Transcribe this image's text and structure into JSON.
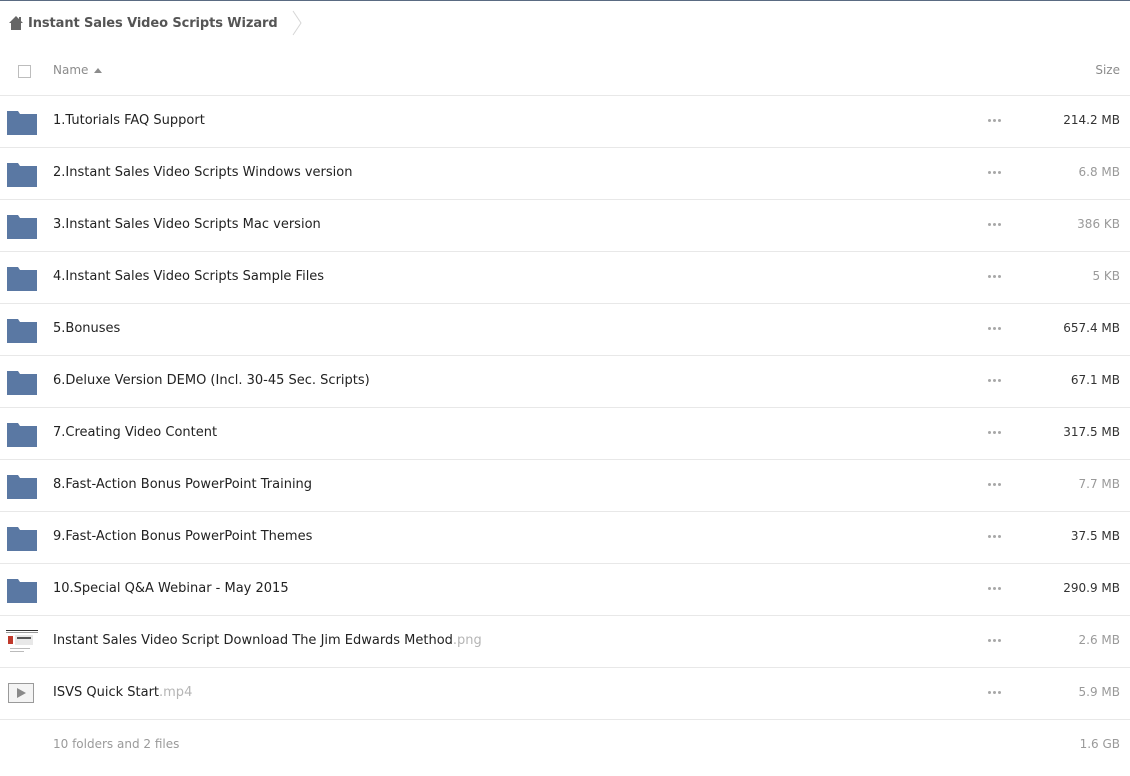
{
  "breadcrumb": {
    "home_icon": "home-icon",
    "title": "Instant Sales Video Scripts Wizard"
  },
  "header": {
    "name_label": "Name",
    "size_label": "Size",
    "sort": "ascending"
  },
  "colors": {
    "folder": "#5a78a3",
    "row_border": "#e8e8e8"
  },
  "rows": [
    {
      "type": "folder",
      "name": "1.Tutorials FAQ Support",
      "ext": "",
      "size": "214.2 MB"
    },
    {
      "type": "folder",
      "name": "2.Instant Sales Video Scripts Windows version",
      "ext": "",
      "size": "6.8 MB"
    },
    {
      "type": "folder",
      "name": "3.Instant Sales Video Scripts Mac version",
      "ext": "",
      "size": "386 KB"
    },
    {
      "type": "folder",
      "name": "4.Instant Sales Video Scripts Sample Files",
      "ext": "",
      "size": "5 KB"
    },
    {
      "type": "folder",
      "name": "5.Bonuses",
      "ext": "",
      "size": "657.4 MB"
    },
    {
      "type": "folder",
      "name": "6.Deluxe Version DEMO (Incl. 30-45 Sec. Scripts)",
      "ext": "",
      "size": "67.1 MB"
    },
    {
      "type": "folder",
      "name": "7.Creating Video Content",
      "ext": "",
      "size": "317.5 MB"
    },
    {
      "type": "folder",
      "name": "8.Fast-Action Bonus PowerPoint Training",
      "ext": "",
      "size": "7.7 MB"
    },
    {
      "type": "folder",
      "name": "9.Fast-Action Bonus PowerPoint Themes",
      "ext": "",
      "size": "37.5 MB"
    },
    {
      "type": "folder",
      "name": "10.Special Q&A Webinar - May 2015",
      "ext": "",
      "size": "290.9 MB"
    },
    {
      "type": "image",
      "name": "Instant Sales Video Script Download The Jim Edwards Method",
      "ext": ".png",
      "size": "2.6 MB"
    },
    {
      "type": "video",
      "name": "ISVS Quick Start",
      "ext": ".mp4",
      "size": "5.9 MB"
    }
  ],
  "footer": {
    "summary": "10 folders and 2 files",
    "total": "1.6 GB"
  }
}
